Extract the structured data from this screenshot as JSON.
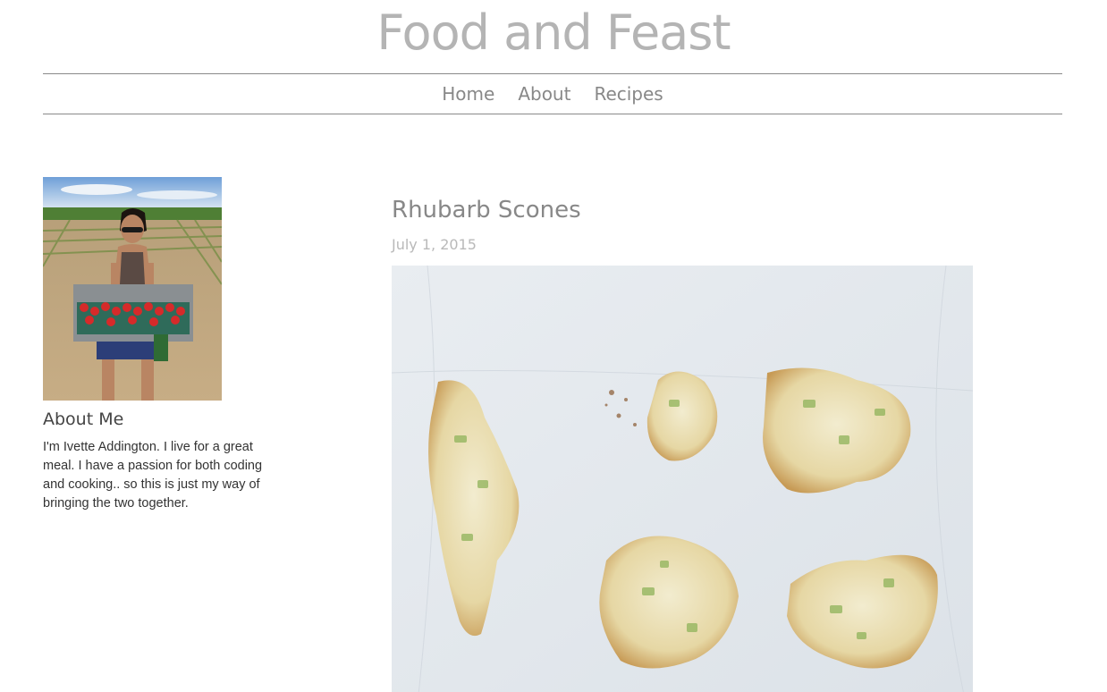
{
  "site": {
    "title": "Food and Feast"
  },
  "nav": {
    "items": [
      {
        "label": "Home"
      },
      {
        "label": "About"
      },
      {
        "label": "Recipes"
      }
    ]
  },
  "sidebar": {
    "about_heading": "About Me",
    "about_text": "I'm Ivette Addington. I live for a great meal. I have a passion for both coding and cooking.. so this is just my way of bringing the two together."
  },
  "post": {
    "title": "Rhubarb Scones",
    "date": "July 1, 2015"
  },
  "colors": {
    "title": "#b4b4b4",
    "nav_text": "#888888",
    "rule": "#8a8a8a",
    "date": "#b9b9b9"
  }
}
